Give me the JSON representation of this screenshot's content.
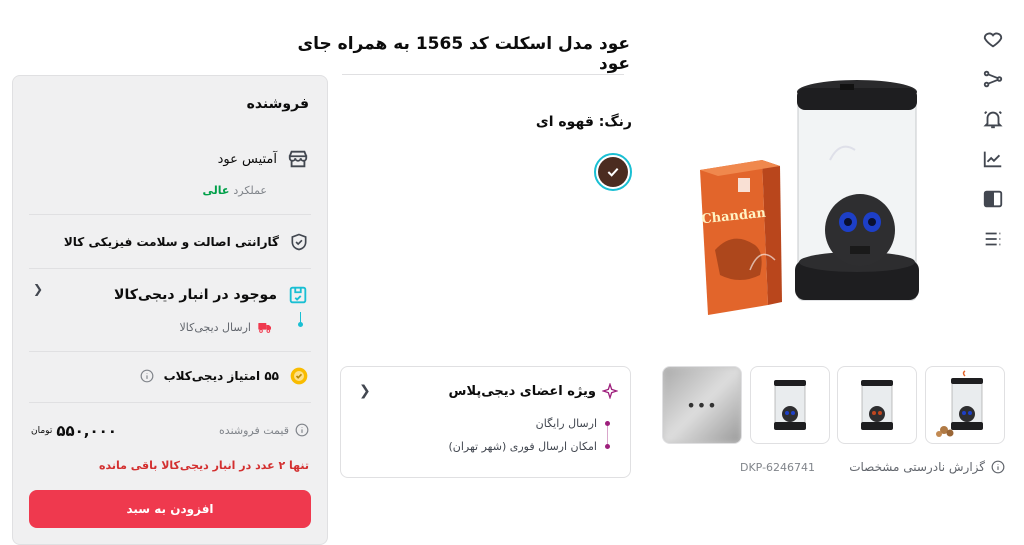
{
  "product": {
    "title": "عود مدل اسکلت کد 1565 به همراه جای عود",
    "color_label": "رنگ: قهوه ای",
    "color_hex": "#4b2c20",
    "dkp": "DKP-6246741",
    "report_label": "گزارش نادرستی مشخصات",
    "box_brand": "Chandan"
  },
  "icons": [
    "heart-icon",
    "share-icon",
    "bell-icon",
    "chart-icon",
    "compare-icon",
    "list-icon"
  ],
  "digiplus": {
    "title": "ویژه اعضای دیجی‌پلاس",
    "items": [
      "ارسال رایگان",
      "امکان ارسال فوری (شهر تهران)"
    ]
  },
  "seller": {
    "section_title": "فروشنده",
    "name": "آمتیس عود",
    "performance_label": "عملکرد",
    "performance_value": "عالی",
    "guarantee": "گارانتی اصالت و سلامت فیزیکی کالا",
    "stock_title": "موجود در انبار دیجی‌کالا",
    "shipping": "ارسال دیجی‌کالا",
    "club_points": "۵۵ امتیاز دیجی‌کلاب",
    "price_label": "قیمت فروشنده",
    "price": "۵۵۰,۰۰۰",
    "currency": "تومان",
    "low_stock": "تنها ۲ عدد در انبار دیجی‌کالا باقی مانده",
    "add_to_cart": "افزودن به سبد"
  },
  "thumbs": {
    "more": "•••"
  }
}
